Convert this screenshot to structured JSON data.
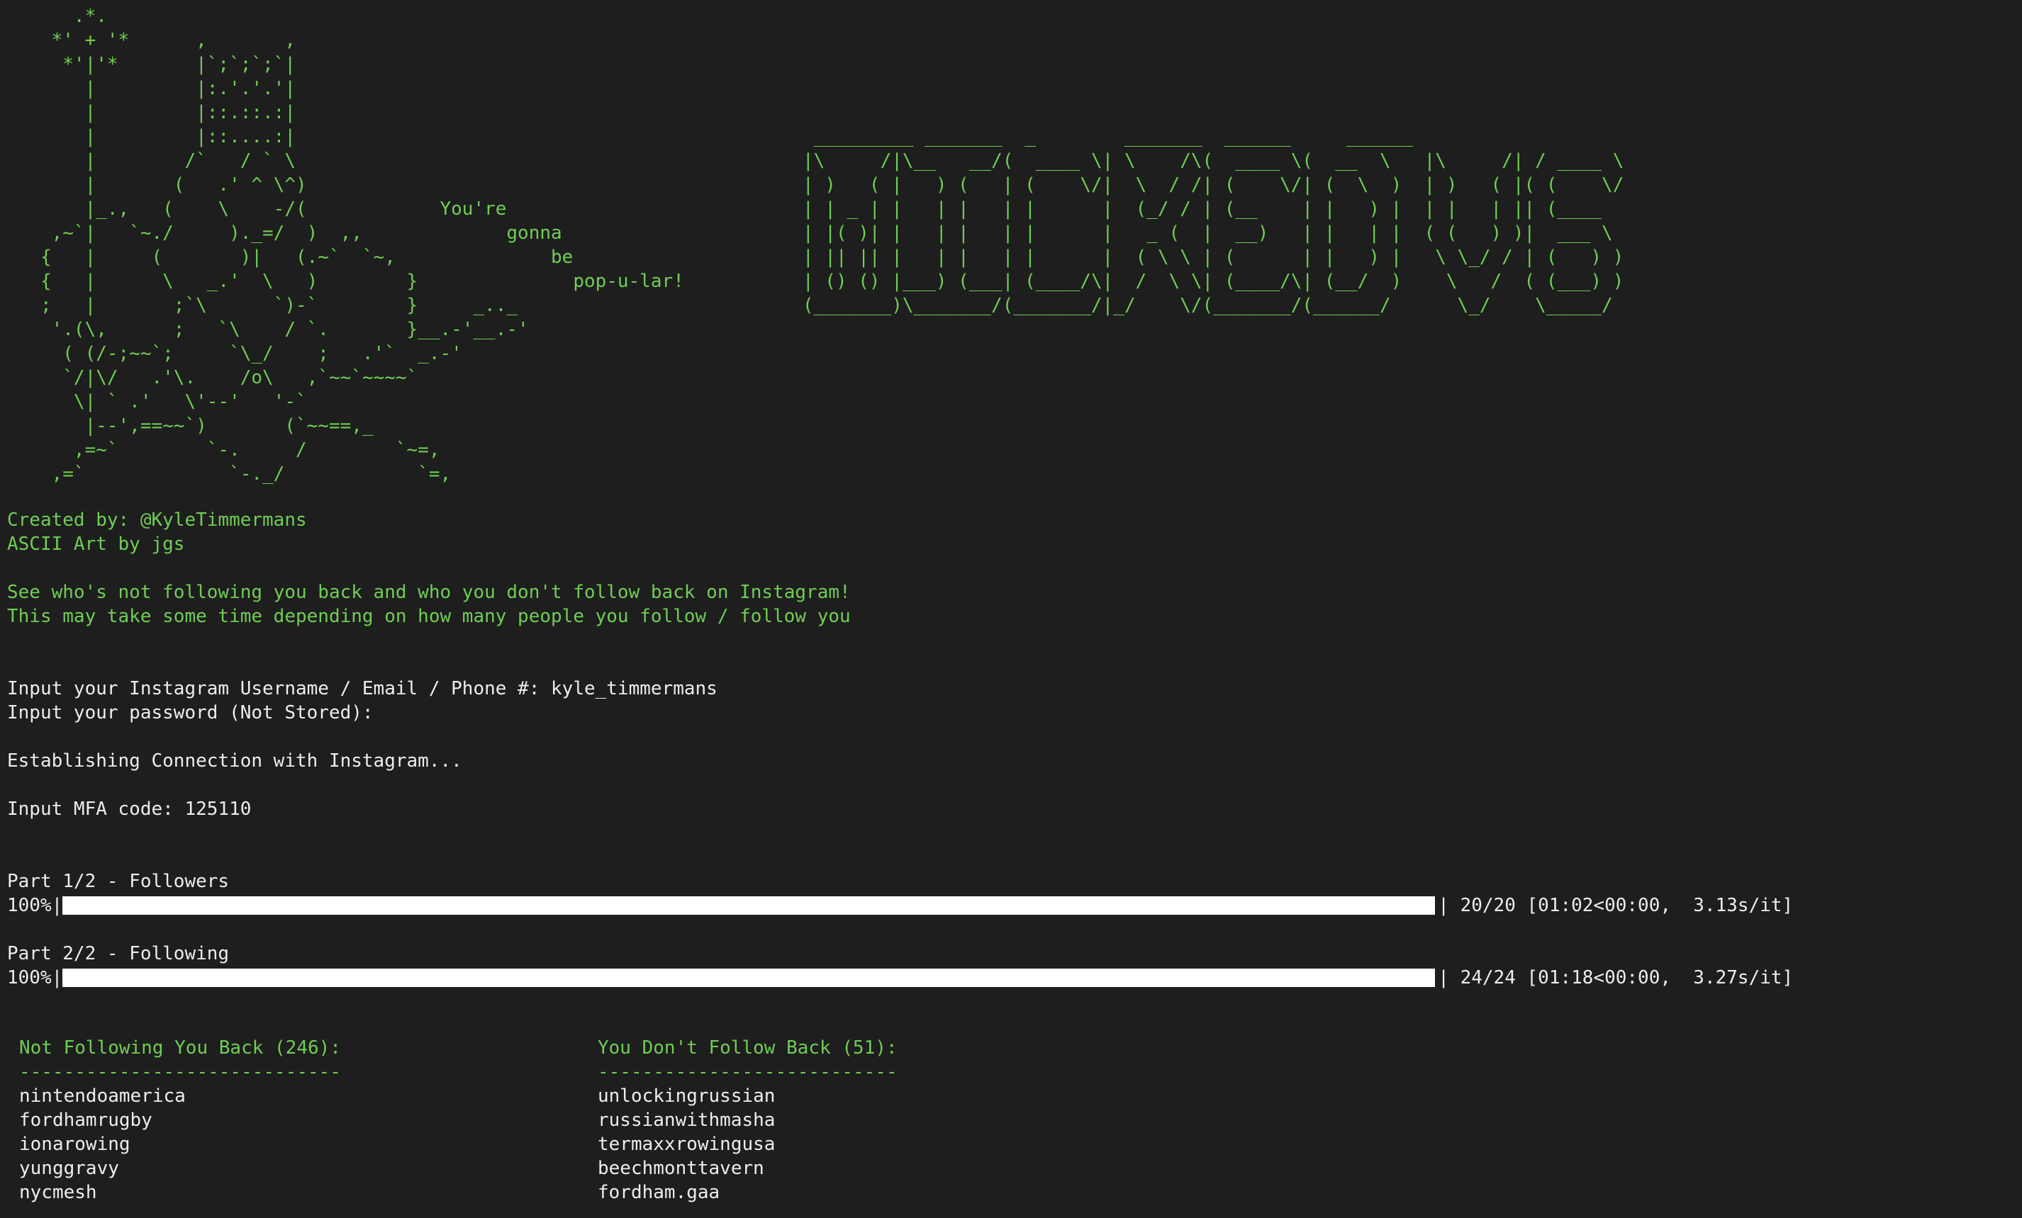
{
  "colors": {
    "background": "#1e1e1e",
    "accent_green": "#6fce53",
    "text_white": "#ededed",
    "bar_fill": "#ffffff"
  },
  "ascii_art": {
    "figure": "      .*.\n    *' + '*      ,       ,\n     *'|'*       |`;`;`;`|\n       |         |:.'.'.'|\n       |         |::.::.:|\n       |         |::....:|\n       |        /`   / ` \\\n       |       (   .' ^ \\^)\n       |_.,   (    \\    -/(            You're\n    ,~`|   `~./     )._=/  )  ,,             gonna\n   {   |     (       )|   (.~`  `~,              be\n   {   |      \\   _.'  \\   )        }              pop-u-lar!\n   ;   |       ;`\\      `)-`        }     _.._\n    '.(\\,      ;   `\\    / `.       }__.-'__.-'\n     ( (/-;~~`;     `\\_/    ;   .'`  _.-'\n     `/|\\/   .'\\.    /o\\   ,`~~`~~~~`\n      \\| ` .'   \\'--'   '-`\n       |--',==~~`)       (`~~==,_\n      ,=~`        `-.     /        `~=,\n    ,=`             `-._/            `=,",
    "logo": " _________ _______  _        _______  ______     ______\n|\\     /|\\__   __/(  ____ \\| \\    /\\(  ____ \\(  __  \\   |\\     /| / ____ \\\n| )   ( |   ) (   | (    \\/|  \\  / /| (    \\/| (  \\  )  | )   ( |( (    \\/\n| | _ | |   | |   | |      |  (_/ / | (__    | |   ) |  | |   | || (____\n| |( )| |   | |   | |      |   _ (  |  __)   | |   | |  ( (   ) )|  ___ \\\n| || || |   | |   | |      |  ( \\ \\ | (      | |   ) |   \\ \\_/ / | (   ) )\n| () () |___) (___| (____/\\|  /  \\ \\| (____/\\| (__/  )    \\   /  ( (___) )\n(_______)\\_______/(_______/|_/    \\/(_______/(______/      \\_/    \\_____/"
  },
  "intro": {
    "created_by": "Created by: @KyleTimmermans",
    "ascii_credit": "ASCII Art by jgs",
    "desc_line1": "See who's not following you back and who you don't follow back on Instagram!",
    "desc_line2": "This may take some time depending on how many people you follow / follow you"
  },
  "session": {
    "username_prompt": "Input your Instagram Username / Email / Phone #: kyle_timmermans",
    "password_prompt": "Input your password (Not Stored):",
    "connecting": "Establishing Connection with Instagram...",
    "mfa_prompt": "Input MFA code: 125110"
  },
  "progress": [
    {
      "title": "Part 1/2 - Followers",
      "percent_label": "100%|",
      "fraction": 1.0,
      "stats": "| 20/20 [01:02<00:00,  3.13s/it]"
    },
    {
      "title": "Part 2/2 - Following",
      "percent_label": "100%|",
      "fraction": 1.0,
      "stats": "| 24/24 [01:18<00:00,  3.27s/it]"
    }
  ],
  "results": {
    "not_following_back": {
      "header": "Not Following You Back (246):",
      "rule": "-----------------------------",
      "items": [
        "nintendoamerica",
        "fordhamrugby",
        "ionarowing",
        "yunggravy",
        "nycmesh"
      ]
    },
    "dont_follow_back": {
      "header": "You Don't Follow Back (51):",
      "rule": "---------------------------",
      "items": [
        "unlockingrussian",
        "russianwithmasha",
        "termaxxrowingusa",
        "beechmonttavern",
        "fordham.gaa"
      ]
    }
  }
}
